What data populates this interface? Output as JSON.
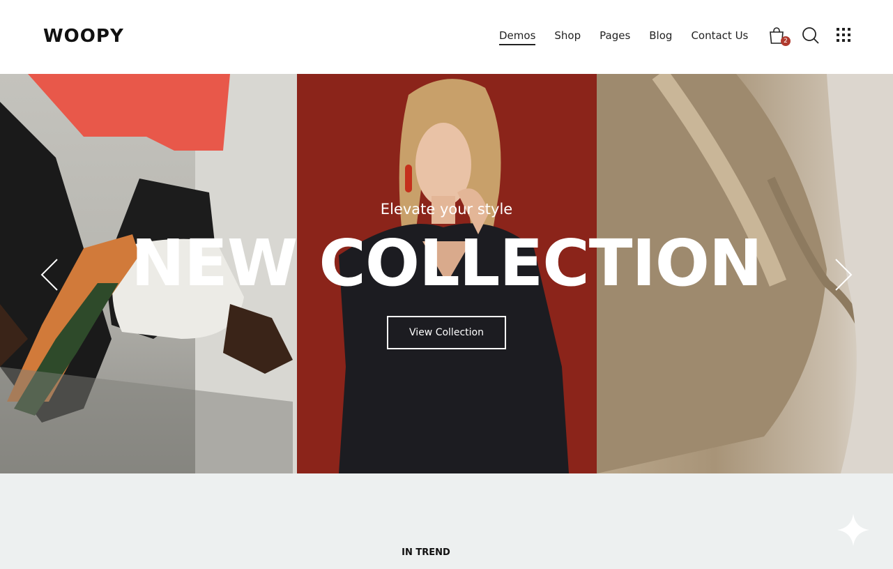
{
  "brand": {
    "logo": "WOOPY"
  },
  "nav": {
    "items": [
      "Demos",
      "Shop",
      "Pages",
      "Blog",
      "Contact Us"
    ],
    "active": "Demos"
  },
  "header_icons": {
    "cart": "shopping-bag-icon",
    "cart_count": "2",
    "search": "search-icon",
    "menu": "grid-menu-icon"
  },
  "hero": {
    "tagline": "Elevate your style",
    "headline": "NEW COLLECTION",
    "cta_label": "View Collection",
    "prev": "chevron-left-icon",
    "next": "chevron-right-icon"
  },
  "section": {
    "label": "IN TREND"
  },
  "colors": {
    "accent": "#b03a2e",
    "section_bg": "#edf0f0",
    "hero_red": "#8b241a"
  }
}
